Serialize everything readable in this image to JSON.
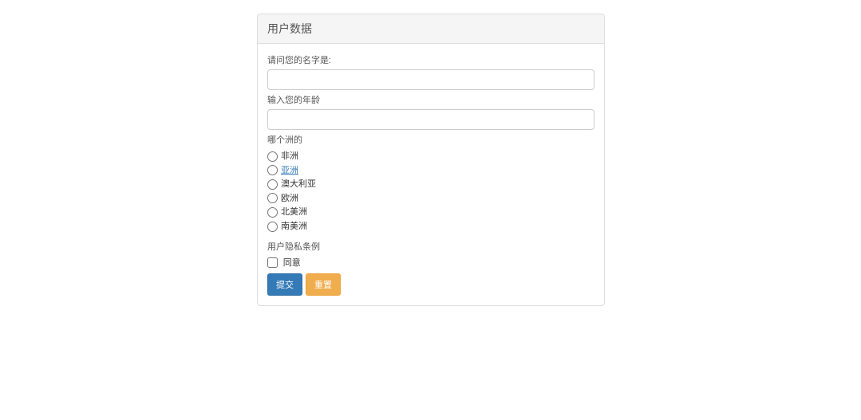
{
  "panel": {
    "title": "用户数据"
  },
  "form": {
    "name_label": "请问您的名字是:",
    "age_label": "输入您的年龄",
    "continent_label": "哪个洲的",
    "continents": [
      {
        "label": "非洲",
        "is_link": false
      },
      {
        "label": "亚洲",
        "is_link": true
      },
      {
        "label": "澳大利亚",
        "is_link": false
      },
      {
        "label": "欧洲",
        "is_link": false
      },
      {
        "label": "北美洲",
        "is_link": false
      },
      {
        "label": "南美洲",
        "is_link": false
      }
    ],
    "privacy_label": "用户隐私条例",
    "agree_label": "同意",
    "submit_label": "提交",
    "reset_label": "重置"
  }
}
